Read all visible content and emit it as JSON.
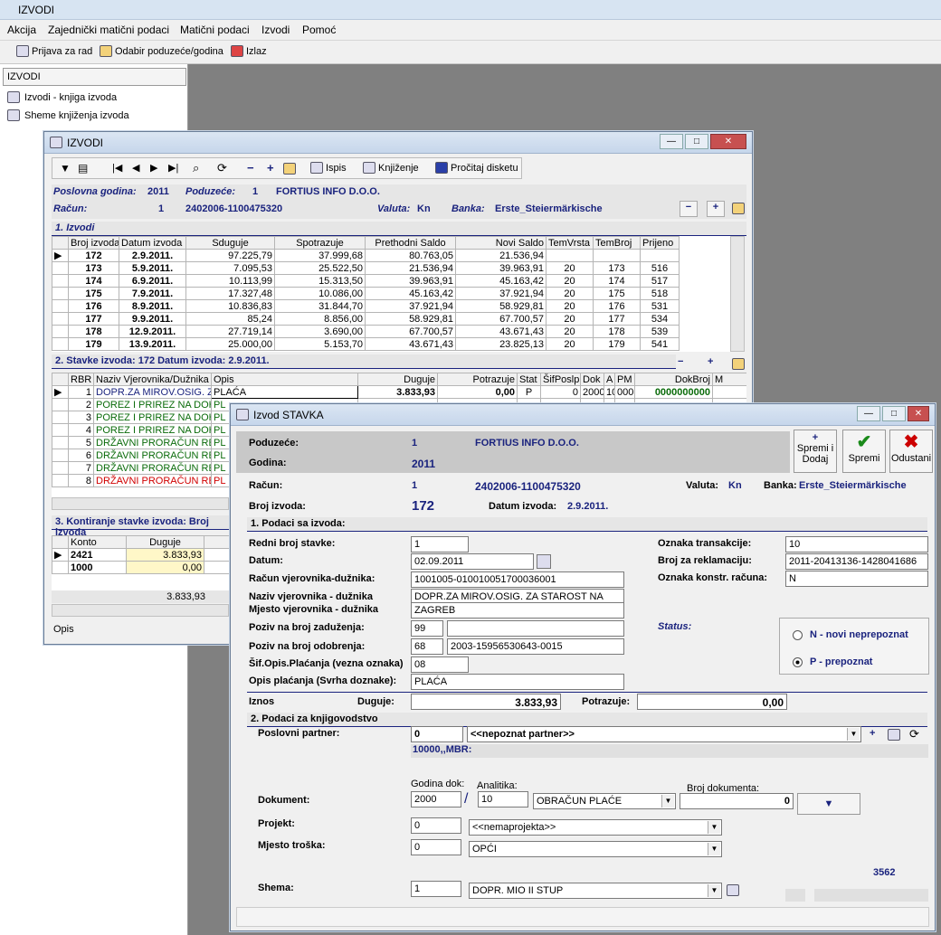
{
  "app": {
    "title": "IZVODI"
  },
  "menu": [
    "Akcija",
    "Zajednički matični podaci",
    "Matični podaci",
    "Izvodi",
    "Pomoć"
  ],
  "toolbar": {
    "login": "Prijava za rad",
    "select_company": "Odabir poduzeće/godina",
    "exit": "Izlaz"
  },
  "sidebar": {
    "header": "IZVODI",
    "items": [
      "Izvodi - knjiga izvoda",
      "Sheme knjiženja izvoda"
    ]
  },
  "izvodi_win": {
    "title": "IZVODI",
    "toolbar": {
      "print": "Ispis",
      "booking": "Knjiženje",
      "read_disk": "Pročitaj disketu"
    },
    "poslovna_godina_label": "Poslovna godina:",
    "poslovna_godina": "2011",
    "poduzece_label": "Poduzeće:",
    "poduzece_id": "1",
    "poduzece_name": "FORTIUS INFO D.O.O.",
    "racun_label": "Račun:",
    "racun_id": "1",
    "racun_num": "2402006-1100475320",
    "valuta_label": "Valuta:",
    "valuta": "Kn",
    "banka_label": "Banka:",
    "banka": "Erste_Steiermärkische",
    "sect1": "1. Izvodi",
    "cols1": [
      "Broj izvoda",
      "Datum izvoda",
      "Sduguje",
      "Spotrazuje",
      "Prethodni Saldo",
      "Novi Saldo",
      "TemVrsta",
      "TemBroj",
      "Prijeno"
    ],
    "rows1": [
      [
        "172",
        "2.9.2011.",
        "97.225,79",
        "37.999,68",
        "80.763,05",
        "21.536,94",
        "",
        "",
        ""
      ],
      [
        "173",
        "5.9.2011.",
        "7.095,53",
        "25.522,50",
        "21.536,94",
        "39.963,91",
        "20",
        "173",
        "516"
      ],
      [
        "174",
        "6.9.2011.",
        "10.113,99",
        "15.313,50",
        "39.963,91",
        "45.163,42",
        "20",
        "174",
        "517"
      ],
      [
        "175",
        "7.9.2011.",
        "17.327,48",
        "10.086,00",
        "45.163,42",
        "37.921,94",
        "20",
        "175",
        "518"
      ],
      [
        "176",
        "8.9.2011.",
        "10.836,83",
        "31.844,70",
        "37.921,94",
        "58.929,81",
        "20",
        "176",
        "531"
      ],
      [
        "177",
        "9.9.2011.",
        "85,24",
        "8.856,00",
        "58.929,81",
        "67.700,57",
        "20",
        "177",
        "534"
      ],
      [
        "178",
        "12.9.2011.",
        "27.719,14",
        "3.690,00",
        "67.700,57",
        "43.671,43",
        "20",
        "178",
        "539"
      ],
      [
        "179",
        "13.9.2011.",
        "25.000,00",
        "5.153,70",
        "43.671,43",
        "23.825,13",
        "20",
        "179",
        "541"
      ]
    ],
    "sect2": "2. Stavke izvoda: 172    Datum izvoda: 2.9.2011.",
    "cols2": [
      "RBR",
      "Naziv Vjerovnika/Dužnika",
      "Opis",
      "Duguje",
      "Potrazuje",
      "Stat",
      "ŠifPoslp",
      "Dok",
      "A",
      "PM",
      "DokBroj",
      "M"
    ],
    "row2_first": [
      "1",
      "DOPR.ZA MIROV.OSIG. Z",
      "PLAĆA",
      "3.833,93",
      "0,00",
      "P",
      "0",
      "2000",
      "10",
      "000",
      "0000000000",
      ""
    ],
    "rows2": [
      {
        "rbr": "2",
        "naziv": "POREZ I PRIREZ NA DOH",
        "opis": "PL",
        "color": "green"
      },
      {
        "rbr": "3",
        "naziv": "POREZ I PRIREZ NA DOH",
        "opis": "PL",
        "color": "green"
      },
      {
        "rbr": "4",
        "naziv": "POREZ I PRIREZ NA DOH",
        "opis": "PL",
        "color": "green"
      },
      {
        "rbr": "5",
        "naziv": "DRŽAVNI PRORAČUN RE",
        "opis": "PL",
        "color": "green"
      },
      {
        "rbr": "6",
        "naziv": "DRŽAVNI PRORAČUN RE",
        "opis": "PL",
        "color": "green"
      },
      {
        "rbr": "7",
        "naziv": "DRŽAVNI PRORAČUN RE",
        "opis": "PL",
        "color": "green"
      },
      {
        "rbr": "8",
        "naziv": "DRŽAVNI PRORAČUN RE",
        "opis": "PL",
        "color": "red"
      }
    ],
    "sect3": "3. Kontiranje stavke izvoda: Broj izvoda",
    "cols3": [
      "Konto",
      "Duguje"
    ],
    "rows3": [
      [
        "2421",
        "3.833,93"
      ],
      [
        "1000",
        "0,00"
      ]
    ],
    "total3": "3.833,93",
    "opis_label": "Opis"
  },
  "stavka": {
    "title": "Izvod STAVKA",
    "btn_save_add": "Spremi i Dodaj",
    "btn_save": "Spremi",
    "btn_cancel": "Odustani",
    "poduzece_label": "Poduzeće:",
    "poduzece_id": "1",
    "poduzece_name": "FORTIUS INFO D.O.O.",
    "godina_label": "Godina:",
    "godina": "2011",
    "racun_label": "Račun:",
    "racun_id": "1",
    "racun_num": "2402006-1100475320",
    "valuta_label": "Valuta:",
    "valuta": "Kn",
    "banka_label": "Banka:",
    "banka": "Erste_Steiermärkische",
    "broj_izvoda_label": "Broj izvoda:",
    "broj_izvoda": "172",
    "datum_izvoda_label": "Datum izvoda:",
    "datum_izvoda": "2.9.2011.",
    "sect1": "1. Podaci sa izvoda:",
    "redni_label": "Redni broj stavke:",
    "redni": "1",
    "datum_label": "Datum:",
    "datum": "02.09.2011",
    "racun_vd_label": "Račun vjerovnika-dužnika:",
    "racun_vd": "1001005-010010051700036001",
    "naziv_vd_label": "Naziv vjerovnika - dužnika",
    "naziv_vd": "DOPR.ZA MIROV.OSIG. ZA STAROST NA",
    "mjesto_vd_label": "Mjesto vjerovnika - dužnika",
    "mjesto_vd": "ZAGREB",
    "poziv_zad_label": "Poziv na broj zaduženja:",
    "poziv_zad_model": "99",
    "poziv_zad": "",
    "poziv_odo_label": "Poziv na broj odobrenja:",
    "poziv_odo_model": "68",
    "poziv_odo": "2003-15956530643-0015",
    "sif_label": "Šif.Opis.Plaćanja (vezna oznaka)",
    "sif": "08",
    "opis_label": "Opis plaćanja (Svrha doznake):",
    "opis": "PLAĆA",
    "oznaka_tr_label": "Oznaka transakcije:",
    "oznaka_tr": "10",
    "broj_rekl_label": "Broj za reklamaciju:",
    "broj_rekl": "2011-20413136-1428041686",
    "oznaka_kr_label": "Oznaka konstr. računa:",
    "oznaka_kr": "N",
    "status_label": "Status:",
    "status_n": "N - novi neprepoznat",
    "status_p": "P - prepoznat",
    "iznos_label": "Iznos",
    "duguje_label": "Duguje:",
    "duguje": "3.833,93",
    "potrazuje_label": "Potrazuje:",
    "potrazuje": "0,00",
    "sect2": "2. Podaci za knjigovodstvo",
    "partner_label": "Poslovni partner:",
    "partner_id": "0",
    "partner": "<<nepoznat partner>>",
    "partner_mbr": "10000,,MBR:",
    "godina_dok_label": "Godina dok:",
    "analitika_label": "Analitika:",
    "broj_dok_label": "Broj dokumenta:",
    "dokument_label": "Dokument:",
    "godina_dok": "2000",
    "analitika": "10",
    "analitika_name": "OBRAČUN PLAĆE",
    "broj_dok": "0",
    "projekt_label": "Projekt:",
    "projekt_id": "0",
    "projekt": "<<nemaprojekta>>",
    "mjesto_label": "Mjesto troška:",
    "mjesto_id": "0",
    "mjesto": "OPĆI",
    "shema_label": "Shema:",
    "shema_id": "1",
    "shema": "DOPR. MIO II STUP",
    "code": "3562"
  }
}
